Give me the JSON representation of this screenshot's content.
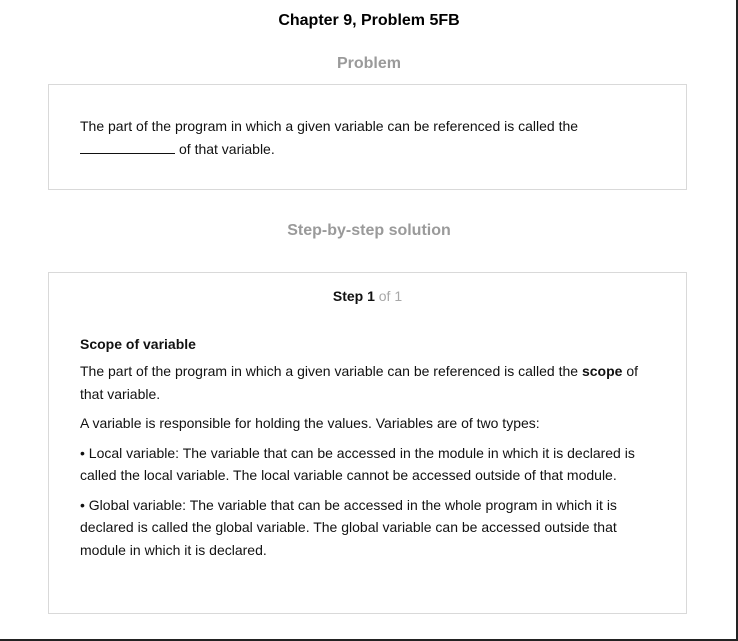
{
  "page": {
    "chapter_title": "Chapter 9, Problem 5FB"
  },
  "problem": {
    "heading": "Problem",
    "text_before_blank": "The part of the program in which a given variable can be referenced is called the",
    "text_after_blank": "of that variable."
  },
  "solution": {
    "heading": "Step-by-step solution",
    "step_word": "Step 1",
    "step_of": "of 1",
    "title": "Scope of variable",
    "para1_before": "The part of the program in which a given variable can be referenced is called the",
    "para1_bold": "scope",
    "para1_after": "of that variable.",
    "para2": "A variable is responsible for holding the values. Variables are of two types:",
    "para3": "• Local variable: The variable that can be accessed in the module in which it is declared is called the local variable. The local variable cannot be accessed outside of that module.",
    "para4": "• Global variable: The variable that can be accessed in the whole program in which it is declared is called the global variable. The global variable can be accessed outside that module in which it is declared."
  }
}
